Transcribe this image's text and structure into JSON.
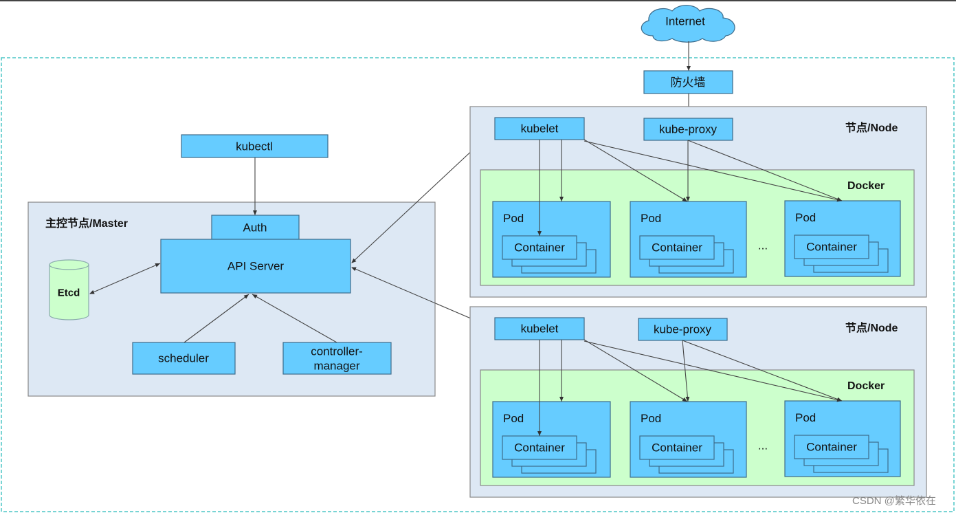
{
  "internet": "Internet",
  "firewall": "防火墙",
  "kubectl": "kubectl",
  "master": {
    "title": "主控节点/Master",
    "auth": "Auth",
    "api_server": "API Server",
    "etcd": "Etcd",
    "scheduler": "scheduler",
    "controller_manager": [
      "controller-",
      "manager"
    ]
  },
  "nodes": [
    {
      "title": "节点/Node",
      "kubelet": "kubelet",
      "kube_proxy": "kube-proxy",
      "docker": "Docker",
      "pods": [
        {
          "label": "Pod",
          "container": "Container"
        },
        {
          "label": "Pod",
          "container": "Container"
        },
        {
          "label": "Pod",
          "container": "Container"
        }
      ],
      "ellipsis": "..."
    },
    {
      "title": "节点/Node",
      "kubelet": "kubelet",
      "kube_proxy": "kube-proxy",
      "docker": "Docker",
      "pods": [
        {
          "label": "Pod",
          "container": "Container"
        },
        {
          "label": "Pod",
          "container": "Container"
        },
        {
          "label": "Pod",
          "container": "Container"
        }
      ],
      "ellipsis": "..."
    }
  ],
  "watermark": "CSDN @繁华依在",
  "colors": {
    "component": "#66ccff",
    "node_bg": "#dde8f4",
    "docker_bg": "#ccffcc",
    "cluster_border": "#4cc6c6",
    "etcd": "#ccffcc"
  }
}
